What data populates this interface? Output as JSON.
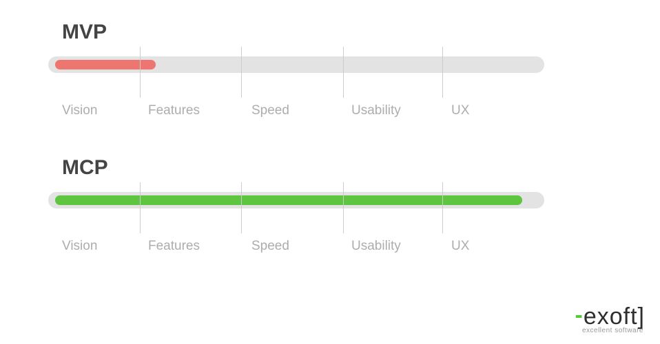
{
  "chart_data": [
    {
      "type": "bar",
      "title": "MVP",
      "categories": [
        "Vision",
        "Features",
        "Speed",
        "Usability",
        "UX"
      ],
      "fill_percent": 23,
      "fill_color": "#ed7670",
      "track_color": "#e3e3e3",
      "xlabel": "",
      "ylabel": "",
      "ylim": [
        0,
        100
      ]
    },
    {
      "type": "bar",
      "title": "MCP",
      "categories": [
        "Vision",
        "Features",
        "Speed",
        "Usability",
        "UX"
      ],
      "fill_percent": 97,
      "fill_color": "#5dc540",
      "track_color": "#e3e3e3",
      "xlabel": "",
      "ylabel": "",
      "ylim": [
        0,
        100
      ]
    }
  ],
  "labels": {
    "vision": "Vision",
    "features": "Features",
    "speed": "Speed",
    "usability": "Usability",
    "ux": "UX"
  },
  "logo": {
    "name": "exoft",
    "tagline": "excellent software"
  }
}
